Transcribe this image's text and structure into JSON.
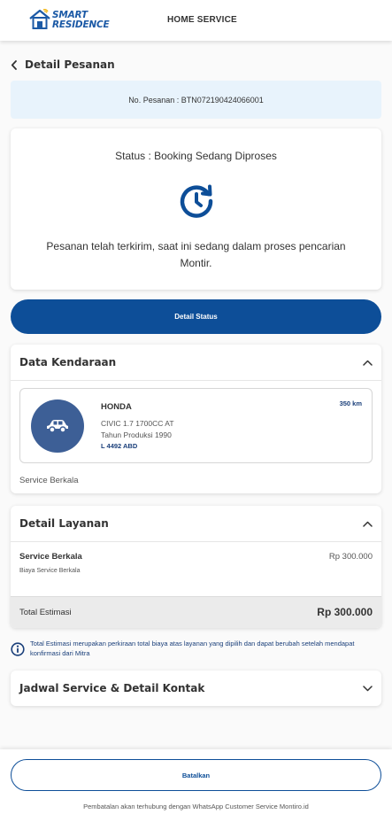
{
  "header": {
    "logo_line1": "SMART",
    "logo_line2": "RESIDENCE",
    "title": "HOME SERVICE"
  },
  "page": {
    "back_title": "Detail Pesanan"
  },
  "order": {
    "number_text": "No. Pesanan : BTN072190424066001"
  },
  "status": {
    "label": "Status : Booking Sedang Diproses",
    "message": "Pesanan telah terkirim, saat ini sedang dalam proses pencarian Montir.",
    "icon": "clock-refresh-icon"
  },
  "buttons": {
    "detail_status": "Detail Status",
    "cancel": "Batalkan"
  },
  "vehicle_section": {
    "title": "Data Kendaraan",
    "brand": "HONDA",
    "model": "CIVIC 1.7 1700CC AT",
    "year": "Tahun Produksi 1990",
    "plate": "L 4492 ABD",
    "km": "350 km",
    "service_type": "Service Berkala"
  },
  "service_section": {
    "title": "Detail Layanan",
    "item_name": "Service Berkala",
    "item_price": "Rp 300.000",
    "item_desc": "Biaya Service Berkala",
    "total_label": "Total Estimasi",
    "total_value": "Rp 300.000"
  },
  "info_note": "Total Estimasi merupakan perkiraan total biaya atas layanan yang dipilih dan dapat berubah setelah mendapat konfirmasi dari Mitra",
  "schedule_section": {
    "title": "Jadwal Service & Detail Kontak"
  },
  "cancel_note": "Pembatalan akan terhubung dengan WhatsApp Customer Service Montiro.id",
  "colors": {
    "primary": "#0d4e98",
    "brand": "#1c5aa6",
    "order_box_bg": "#e8f3fc",
    "car_circle": "#3d5f96"
  }
}
